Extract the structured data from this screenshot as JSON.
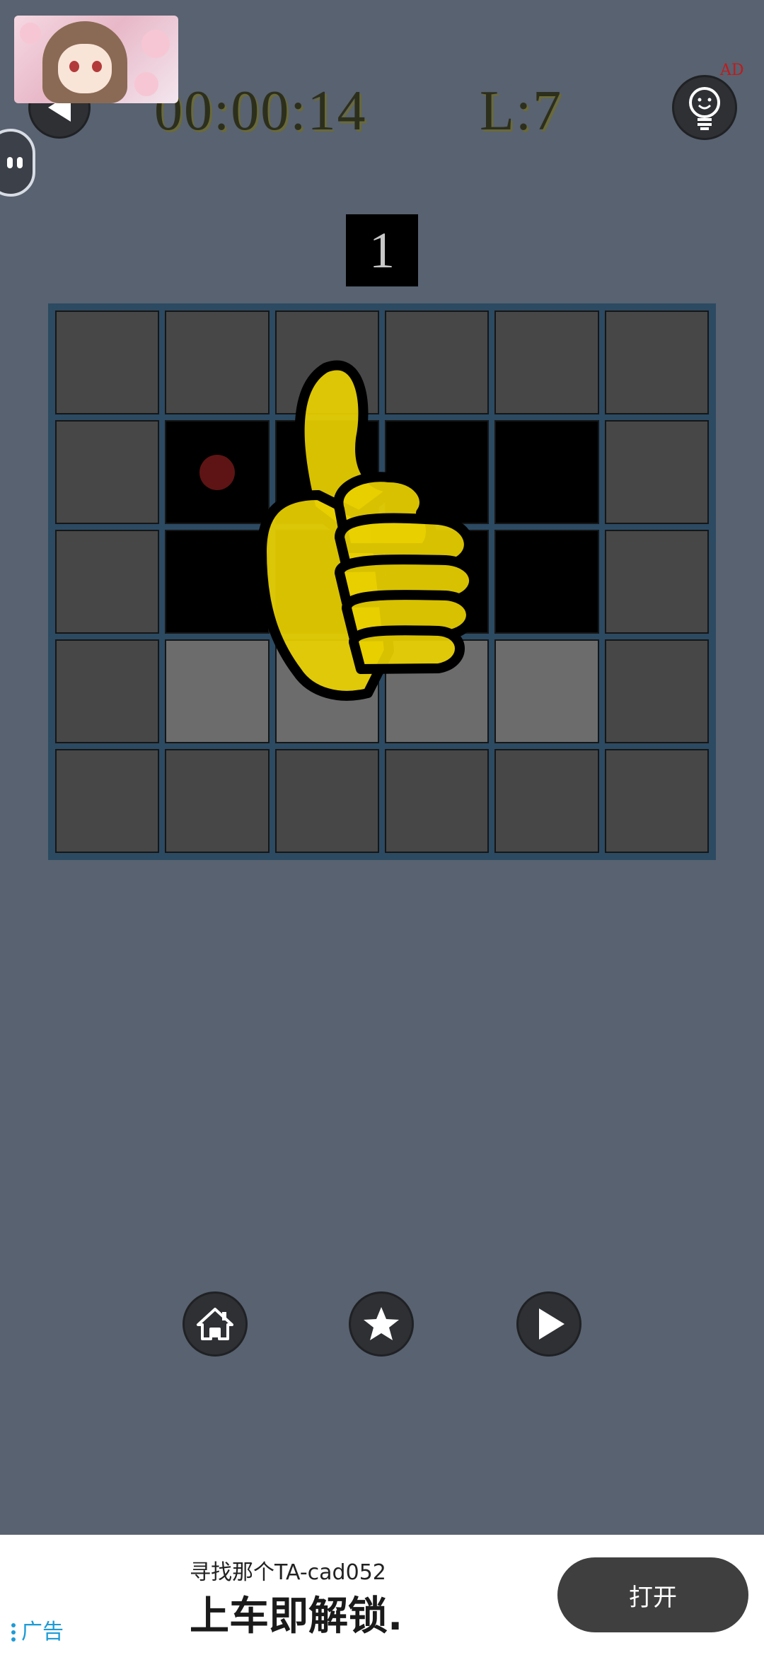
{
  "header": {
    "timer": "00:00:14",
    "level": "L:7",
    "hint_ad_tag": "AD",
    "back_icon": "back-arrow-icon",
    "hint_icon": "lightbulb-icon"
  },
  "counter": "1",
  "board": {
    "cols": 6,
    "rows": 5,
    "cells": [
      [
        "wall",
        "wall",
        "wall",
        "wall",
        "wall",
        "wall"
      ],
      [
        "wall",
        "dark",
        "dark",
        "dark",
        "dark",
        "wall"
      ],
      [
        "wall",
        "dark",
        "dark",
        "dark",
        "dark",
        "wall"
      ],
      [
        "wall",
        "lit",
        "lit",
        "lit",
        "lit",
        "wall"
      ],
      [
        "wall",
        "wall",
        "wall",
        "wall",
        "wall",
        "wall"
      ]
    ],
    "player_cell": [
      1,
      1
    ],
    "overlay": "thumbs-up-icon"
  },
  "controls": [
    {
      "name": "home-button",
      "icon": "home-icon"
    },
    {
      "name": "star-button",
      "icon": "star-icon"
    },
    {
      "name": "play-button",
      "icon": "play-icon"
    }
  ],
  "ad": {
    "label": "广告",
    "subtitle": "寻找那个TA-cad052",
    "title": "上车即解锁.",
    "button": "打开"
  },
  "colors": {
    "background": "#586270",
    "board_frame": "#2c4a62",
    "thumbs_yellow": "#e8d000"
  }
}
